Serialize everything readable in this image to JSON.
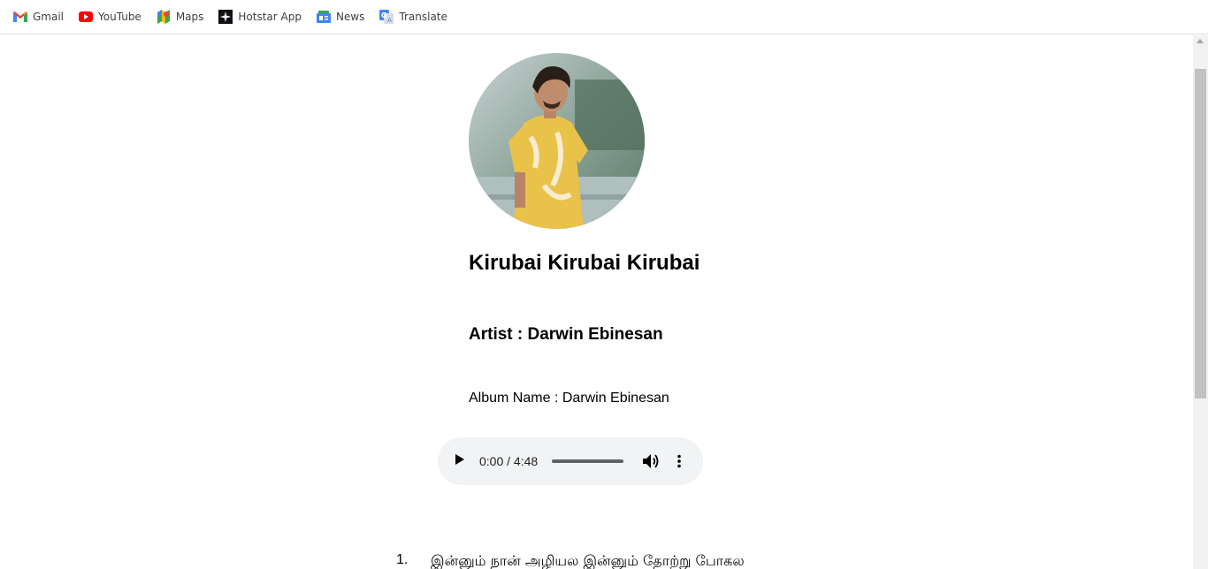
{
  "bookmarks": [
    {
      "label": "Gmail",
      "icon": "gmail-icon"
    },
    {
      "label": "YouTube",
      "icon": "youtube-icon"
    },
    {
      "label": "Maps",
      "icon": "maps-icon"
    },
    {
      "label": "Hotstar App",
      "icon": "hotstar-icon"
    },
    {
      "label": "News",
      "icon": "news-icon"
    },
    {
      "label": "Translate",
      "icon": "translate-icon"
    }
  ],
  "song": {
    "title": "Kirubai Kirubai Kirubai",
    "artist": "Artist : Darwin Ebinesan",
    "album": "Album Name : Darwin Ebinesan"
  },
  "player": {
    "time": "0:00 / 4:48",
    "progress": 0
  },
  "lyrics": [
    {
      "number": "1.",
      "text": "இன்னும் நான் அழியல இன்னும் தோற்று போகல"
    }
  ],
  "colors": {
    "player_bg": "#f1f3f4",
    "bookmark_text": "#3c4043",
    "shirt": "#e9c24a"
  }
}
